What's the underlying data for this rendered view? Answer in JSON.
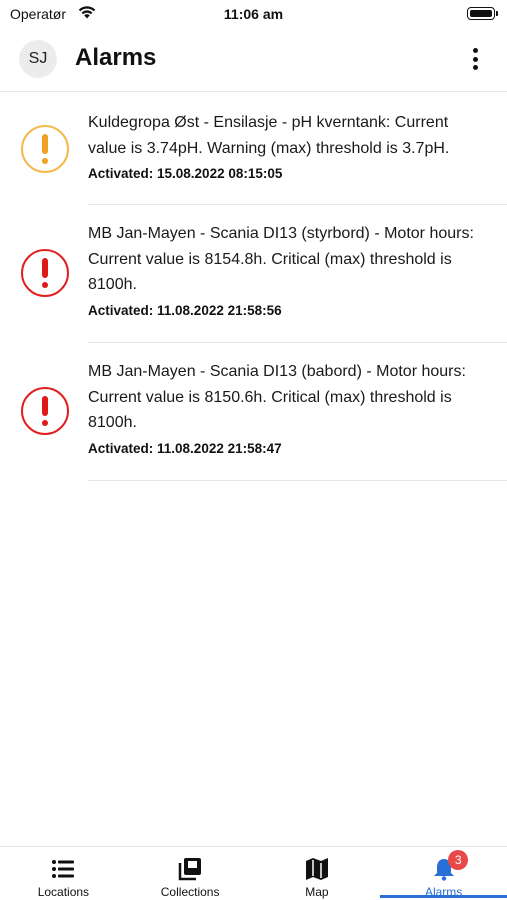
{
  "status_bar": {
    "carrier": "Operatør",
    "time": "11:06 am"
  },
  "header": {
    "avatar_initials": "SJ",
    "title": "Alarms",
    "menu_icon": "more-vertical-icon"
  },
  "colors": {
    "warning": "#f0a020",
    "critical": "#e01818",
    "accent": "#2a6fd6",
    "badge": "#e84848"
  },
  "alarms": [
    {
      "severity": "warning",
      "icon": "warning-icon",
      "message": "Kuldegropa Øst - Ensilasje - pH kverntank: Current value is 3.74pH. Warning (max) threshold is 3.7pH.",
      "activated": "Activated: 15.08.2022 08:15:05"
    },
    {
      "severity": "critical",
      "icon": "critical-icon",
      "message": "MB Jan-Mayen - Scania DI13 (styrbord) - Motor hours: Current value is 8154.8h. Critical (max) threshold is 8100h.",
      "activated": "Activated: 11.08.2022 21:58:56"
    },
    {
      "severity": "critical",
      "icon": "critical-icon",
      "message": "MB Jan-Mayen - Scania DI13 (babord) - Motor hours: Current value is 8150.6h. Critical (max) threshold is 8100h.",
      "activated": "Activated: 11.08.2022 21:58:47"
    }
  ],
  "tab_bar": {
    "tabs": [
      {
        "label": "Locations",
        "icon": "list-icon",
        "active": false
      },
      {
        "label": "Collections",
        "icon": "collections-icon",
        "active": false
      },
      {
        "label": "Map",
        "icon": "map-icon",
        "active": false
      },
      {
        "label": "Alarms",
        "icon": "bell-icon",
        "active": true,
        "badge": "3"
      }
    ]
  }
}
